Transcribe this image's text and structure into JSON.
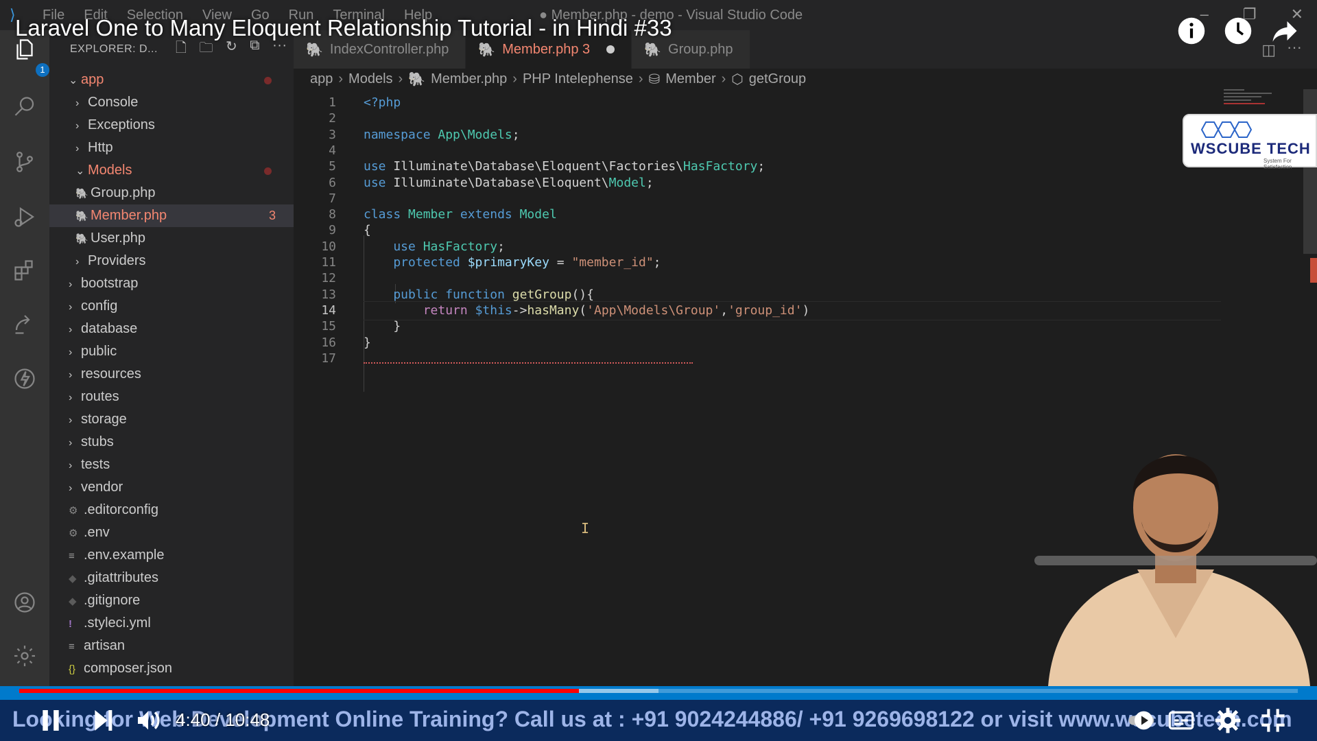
{
  "window": {
    "menu": [
      "File",
      "Edit",
      "Selection",
      "View",
      "Go",
      "Run",
      "Terminal",
      "Help"
    ],
    "title": "● Member.php - demo - Visual Studio Code"
  },
  "activity_bar": {
    "explorer_badge": "1"
  },
  "sidebar": {
    "header": "EXPLORER: D...",
    "tree": [
      {
        "label": "app",
        "level": 0,
        "kind": "folder-open",
        "modified": true,
        "error": true
      },
      {
        "label": "Console",
        "level": 1,
        "kind": "folder"
      },
      {
        "label": "Exceptions",
        "level": 1,
        "kind": "folder"
      },
      {
        "label": "Http",
        "level": 1,
        "kind": "folder"
      },
      {
        "label": "Models",
        "level": 1,
        "kind": "folder-open",
        "modified": true,
        "error": true
      },
      {
        "label": "Group.php",
        "level": 2,
        "kind": "php"
      },
      {
        "label": "Member.php",
        "level": 2,
        "kind": "php",
        "selected": true,
        "error": true,
        "count": "3"
      },
      {
        "label": "User.php",
        "level": 2,
        "kind": "php"
      },
      {
        "label": "Providers",
        "level": 1,
        "kind": "folder"
      },
      {
        "label": "bootstrap",
        "level": 0,
        "kind": "folder"
      },
      {
        "label": "config",
        "level": 0,
        "kind": "folder"
      },
      {
        "label": "database",
        "level": 0,
        "kind": "folder"
      },
      {
        "label": "public",
        "level": 0,
        "kind": "folder"
      },
      {
        "label": "resources",
        "level": 0,
        "kind": "folder"
      },
      {
        "label": "routes",
        "level": 0,
        "kind": "folder"
      },
      {
        "label": "storage",
        "level": 0,
        "kind": "folder"
      },
      {
        "label": "stubs",
        "level": 0,
        "kind": "folder"
      },
      {
        "label": "tests",
        "level": 0,
        "kind": "folder"
      },
      {
        "label": "vendor",
        "level": 0,
        "kind": "folder"
      },
      {
        "label": ".editorconfig",
        "level": 0,
        "kind": "gear"
      },
      {
        "label": ".env",
        "level": 0,
        "kind": "gear"
      },
      {
        "label": ".env.example",
        "level": 0,
        "kind": "lines"
      },
      {
        "label": ".gitattributes",
        "level": 0,
        "kind": "diamond"
      },
      {
        "label": ".gitignore",
        "level": 0,
        "kind": "diamond"
      },
      {
        "label": ".styleci.yml",
        "level": 0,
        "kind": "excl"
      },
      {
        "label": "artisan",
        "level": 0,
        "kind": "lines"
      },
      {
        "label": "composer.json",
        "level": 0,
        "kind": "brace"
      }
    ]
  },
  "tabs": [
    {
      "label": "IndexController.php",
      "active": false
    },
    {
      "label": "Member.php 3",
      "active": true,
      "dirty": true
    },
    {
      "label": "Group.php",
      "active": false
    }
  ],
  "breadcrumb": [
    "app",
    "Models",
    "Member.php",
    "PHP Intelephense",
    "Member",
    "getGroup"
  ],
  "editor": {
    "current_line": 14,
    "lines": [
      [
        {
          "t": "<?php",
          "c": "kw"
        }
      ],
      [],
      [
        {
          "t": "namespace ",
          "c": "kw"
        },
        {
          "t": "App\\Models",
          "c": "cls"
        },
        {
          "t": ";",
          "c": ""
        }
      ],
      [],
      [
        {
          "t": "use ",
          "c": "kw"
        },
        {
          "t": "Illuminate\\Database\\Eloquent\\Factories\\",
          "c": ""
        },
        {
          "t": "HasFactory",
          "c": "cls"
        },
        {
          "t": ";",
          "c": ""
        }
      ],
      [
        {
          "t": "use ",
          "c": "kw"
        },
        {
          "t": "Illuminate\\Database\\Eloquent\\",
          "c": ""
        },
        {
          "t": "Model",
          "c": "cls"
        },
        {
          "t": ";",
          "c": ""
        }
      ],
      [],
      [
        {
          "t": "class ",
          "c": "kw"
        },
        {
          "t": "Member ",
          "c": "cls"
        },
        {
          "t": "extends ",
          "c": "kw"
        },
        {
          "t": "Model",
          "c": "cls"
        }
      ],
      [
        {
          "t": "{",
          "c": ""
        }
      ],
      [
        {
          "t": "    use ",
          "c": "kw"
        },
        {
          "t": "HasFactory",
          "c": "cls"
        },
        {
          "t": ";",
          "c": ""
        }
      ],
      [
        {
          "t": "    protected ",
          "c": "kw"
        },
        {
          "t": "$primaryKey",
          "c": "var"
        },
        {
          "t": " = ",
          "c": ""
        },
        {
          "t": "\"member_id\"",
          "c": "str"
        },
        {
          "t": ";",
          "c": ""
        }
      ],
      [],
      [
        {
          "t": "    public ",
          "c": "kw"
        },
        {
          "t": "function ",
          "c": "kw"
        },
        {
          "t": "getGroup",
          "c": "fn"
        },
        {
          "t": "(){",
          "c": ""
        }
      ],
      [
        {
          "t": "        return ",
          "c": "ctrl"
        },
        {
          "t": "$this",
          "c": "kw"
        },
        {
          "t": "->",
          "c": ""
        },
        {
          "t": "hasMany",
          "c": "fn"
        },
        {
          "t": "(",
          "c": ""
        },
        {
          "t": "'App\\Models\\Group'",
          "c": "str"
        },
        {
          "t": ",",
          "c": ""
        },
        {
          "t": "'group_id'",
          "c": "str"
        },
        {
          "t": ")",
          "c": ""
        }
      ],
      [
        {
          "t": "    }",
          "c": ""
        }
      ],
      [
        {
          "t": "}",
          "c": ""
        }
      ],
      []
    ]
  },
  "logo": {
    "name": "WSCUBE TECH",
    "tagline": "System For Satisfaction"
  },
  "video": {
    "title": "Laravel One to Many Eloquent Relationship Tutorial - in Hindi #33",
    "time_current": "4:40",
    "time_total": "10:48",
    "timecode": "4:40 / 10:48",
    "progress": 0.4375,
    "buffered": 0.5,
    "ticker": "Looking for Web Development Online Training? Call us at : +91 9024244886/ +91 9269698122 or visit www.wscubetech.com"
  },
  "colors": {
    "accent_red": "#ff0000",
    "error": "#f48771",
    "ticker_bg": "#0b2a5c"
  }
}
